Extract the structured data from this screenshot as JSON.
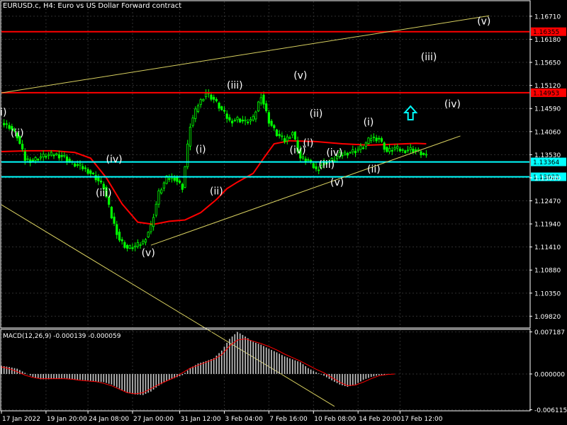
{
  "header": {
    "symbol_line": "EURUSD.c, H4:  Euro vs US Dollar Forward contract"
  },
  "macd_panel": {
    "label": "MACD(12,26,9) -0.000139 -0.000059"
  },
  "colors": {
    "background": "#000000",
    "grid": "#2f2f2f",
    "candle": "#00ff00",
    "ma_line": "#ff0000",
    "trendline": "#d8d060",
    "support_line": "#00ffff",
    "resistance_line": "#e00000",
    "wave_label": "#ffffff",
    "up_arrow": "#00ffff",
    "macd_hist": "#c8c8c8",
    "macd_signal": "#ff0000",
    "axis_text": "#ffffff",
    "price_tag_red": "#ff0000",
    "price_tag_cyan": "#00ffff"
  },
  "chart_data": [
    {
      "type": "candlestick",
      "title": "EURUSD.c, H4:  Euro vs US Dollar Forward contract",
      "ylim": [
        1.0955,
        1.1705
      ],
      "y_ticks": [
        "1.16710",
        "1.16180",
        "1.15650",
        "1.15120",
        "1.14590",
        "1.14060",
        "1.13530",
        "1.13000",
        "1.12470",
        "1.11940",
        "1.11410",
        "1.10880",
        "1.10350",
        "1.09820"
      ],
      "x_ticks": [
        "17 Jan 2022",
        "19 Jan 20:00",
        "24 Jan 08:00",
        "27 Jan 00:00",
        "31 Jan 12:00",
        "3 Feb 04:00",
        "7 Feb 16:00",
        "10 Feb 08:00",
        "14 Feb 20:00",
        "17 Feb 12:00"
      ],
      "grid": true,
      "series": [
        {
          "kind": "close_path",
          "x": [
            0,
            3,
            6,
            9,
            12,
            15,
            18,
            21,
            24,
            27,
            30,
            33,
            36,
            39,
            42,
            45,
            48,
            51,
            54,
            57,
            60,
            63,
            66,
            69,
            72,
            75,
            78,
            81,
            84,
            87,
            90,
            93,
            96,
            99,
            102,
            105,
            108,
            111,
            114,
            117,
            120,
            123,
            126,
            129,
            132,
            135,
            138,
            141,
            144,
            147,
            150,
            153,
            156,
            159,
            162
          ],
          "y": [
            1.1425,
            1.1418,
            1.1395,
            1.1342,
            1.134,
            1.1348,
            1.1352,
            1.1353,
            1.1348,
            1.1332,
            1.1326,
            1.1316,
            1.13,
            1.1278,
            1.121,
            1.1158,
            1.1138,
            1.1142,
            1.1152,
            1.1188,
            1.1265,
            1.1298,
            1.13,
            1.1278,
            1.142,
            1.1468,
            1.1495,
            1.148,
            1.1455,
            1.143,
            1.1435,
            1.1428,
            1.1435,
            1.149,
            1.143,
            1.14,
            1.1385,
            1.1405,
            1.1345,
            1.134,
            1.1318,
            1.1335,
            1.134,
            1.1352,
            1.1358,
            1.1362,
            1.1372,
            1.1392,
            1.139,
            1.136,
            1.1368,
            1.1362,
            1.1366,
            1.136,
            1.1348
          ]
        },
        {
          "kind": "moving_average",
          "x": [
            0,
            10,
            20,
            28,
            34,
            40,
            46,
            52,
            58,
            64,
            70,
            76,
            82,
            86,
            90,
            96,
            100,
            104,
            110,
            120,
            130,
            140,
            150,
            158,
            162
          ],
          "y": [
            1.136,
            1.1362,
            1.1362,
            1.1358,
            1.1345,
            1.13,
            1.124,
            1.1198,
            1.1193,
            1.12,
            1.1203,
            1.122,
            1.125,
            1.1275,
            1.129,
            1.131,
            1.1345,
            1.1378,
            1.1385,
            1.1383,
            1.1378,
            1.1375,
            1.1377,
            1.1379,
            1.1378
          ]
        }
      ],
      "horizontal_lines": [
        {
          "value": 1.16355,
          "label": "1.16355",
          "color": "#ff0000"
        },
        {
          "value": 1.14953,
          "label": "1.14953",
          "color": "#ff0000"
        },
        {
          "value": 1.13364,
          "label": "1.13364",
          "color": "#00ffff"
        },
        {
          "value": 1.13022,
          "label": "1.13022",
          "color": "#00ffff"
        }
      ],
      "wave_labels": [
        {
          "text": "(i)",
          "x": 0,
          "y": 1.1443
        },
        {
          "text": "(ii)",
          "x": 6,
          "y": 1.1395
        },
        {
          "text": "(iii)",
          "x": 39,
          "y": 1.1258
        },
        {
          "text": "(iv)",
          "x": 43,
          "y": 1.1335
        },
        {
          "text": "(v)",
          "x": 56,
          "y": 1.112
        },
        {
          "text": "(i)",
          "x": 76,
          "y": 1.1358
        },
        {
          "text": "(ii)",
          "x": 82,
          "y": 1.1262
        },
        {
          "text": "(iii)",
          "x": 89,
          "y": 1.1505
        },
        {
          "text": "(v)",
          "x": 114,
          "y": 1.1528
        },
        {
          "text": "(ii)",
          "x": 120,
          "y": 1.144
        },
        {
          "text": "(i)",
          "x": 117,
          "y": 1.1372
        },
        {
          "text": "(iv)",
          "x": 113,
          "y": 1.1356
        },
        {
          "text": "(iv)",
          "x": 127,
          "y": 1.135
        },
        {
          "text": "(iii)",
          "x": 124,
          "y": 1.1323
        },
        {
          "text": "(v)",
          "x": 128,
          "y": 1.1282
        },
        {
          "text": "(i)",
          "x": 140,
          "y": 1.142
        },
        {
          "text": "(ii)",
          "x": 142,
          "y": 1.1312
        },
        {
          "text": "(iii)",
          "x": 163,
          "y": 1.157
        },
        {
          "text": "(iv)",
          "x": 172,
          "y": 1.1462
        },
        {
          "text": "(v)",
          "x": 184,
          "y": 1.1652
        }
      ],
      "trendlines": [
        {
          "x": [
            0,
            186
          ],
          "y": [
            1.1495,
            1.1672
          ]
        },
        {
          "x": [
            0,
            127
          ],
          "y": [
            1.1238,
            1.0775
          ]
        },
        {
          "x": [
            57,
            175
          ],
          "y": [
            1.1145,
            1.1396
          ]
        }
      ],
      "annotations": [
        {
          "type": "up_arrow",
          "x": 156,
          "y": 1.1448
        }
      ]
    },
    {
      "type": "bar",
      "title": "MACD(12,26,9) -0.000139 -0.000059",
      "ylim": [
        -0.0063,
        0.0075
      ],
      "y_ticks": [
        "0.007187",
        "0.000000",
        "-0.006115"
      ],
      "x": [
        0,
        3,
        6,
        9,
        12,
        15,
        18,
        21,
        24,
        27,
        30,
        33,
        36,
        39,
        42,
        45,
        48,
        51,
        54,
        57,
        60,
        63,
        66,
        69,
        72,
        75,
        78,
        81,
        84,
        87,
        90,
        93,
        96,
        99,
        102,
        105,
        108,
        111,
        114,
        117,
        120,
        123,
        126,
        129,
        132,
        135,
        138,
        141,
        144,
        147,
        150
      ],
      "series": [
        {
          "name": "histogram",
          "values": [
            0.0014,
            0.0012,
            0.0009,
            0.0002,
            -0.0005,
            -0.0009,
            -0.0009,
            -0.0008,
            -0.0007,
            -0.0009,
            -0.001,
            -0.0011,
            -0.0013,
            -0.0014,
            -0.0018,
            -0.0025,
            -0.0032,
            -0.0035,
            -0.0036,
            -0.003,
            -0.002,
            -0.0012,
            -0.0007,
            -0.0002,
            0.001,
            0.0018,
            0.0022,
            0.0027,
            0.004,
            0.006,
            0.0072,
            0.0064,
            0.0055,
            0.005,
            0.0043,
            0.0037,
            0.003,
            0.0025,
            0.002,
            0.001,
            0.0003,
            -0.0003,
            -0.0011,
            -0.0018,
            -0.0022,
            -0.0018,
            -0.001,
            -0.0005,
            -0.0002,
            -0.0001,
            0.0
          ]
        },
        {
          "name": "signal",
          "values": [
            0.0012,
            0.0009,
            0.0004,
            -0.0002,
            -0.0006,
            -0.0008,
            -0.0008,
            -0.0008,
            -0.0008,
            -0.0009,
            -0.0011,
            -0.0012,
            -0.0013,
            -0.0016,
            -0.002,
            -0.0026,
            -0.0032,
            -0.0034,
            -0.0032,
            -0.0025,
            -0.0018,
            -0.0012,
            -0.0006,
            0.0002,
            0.001,
            0.0015,
            0.002,
            0.0025,
            0.0033,
            0.0048,
            0.0058,
            0.006,
            0.0056,
            0.0052,
            0.0047,
            0.0041,
            0.0034,
            0.0028,
            0.0022,
            0.0015,
            0.0008,
            0.0002,
            -0.0006,
            -0.0014,
            -0.002,
            -0.0019,
            -0.0014,
            -0.0008,
            -0.0003,
            -0.0001,
            0.0
          ]
        }
      ]
    }
  ]
}
